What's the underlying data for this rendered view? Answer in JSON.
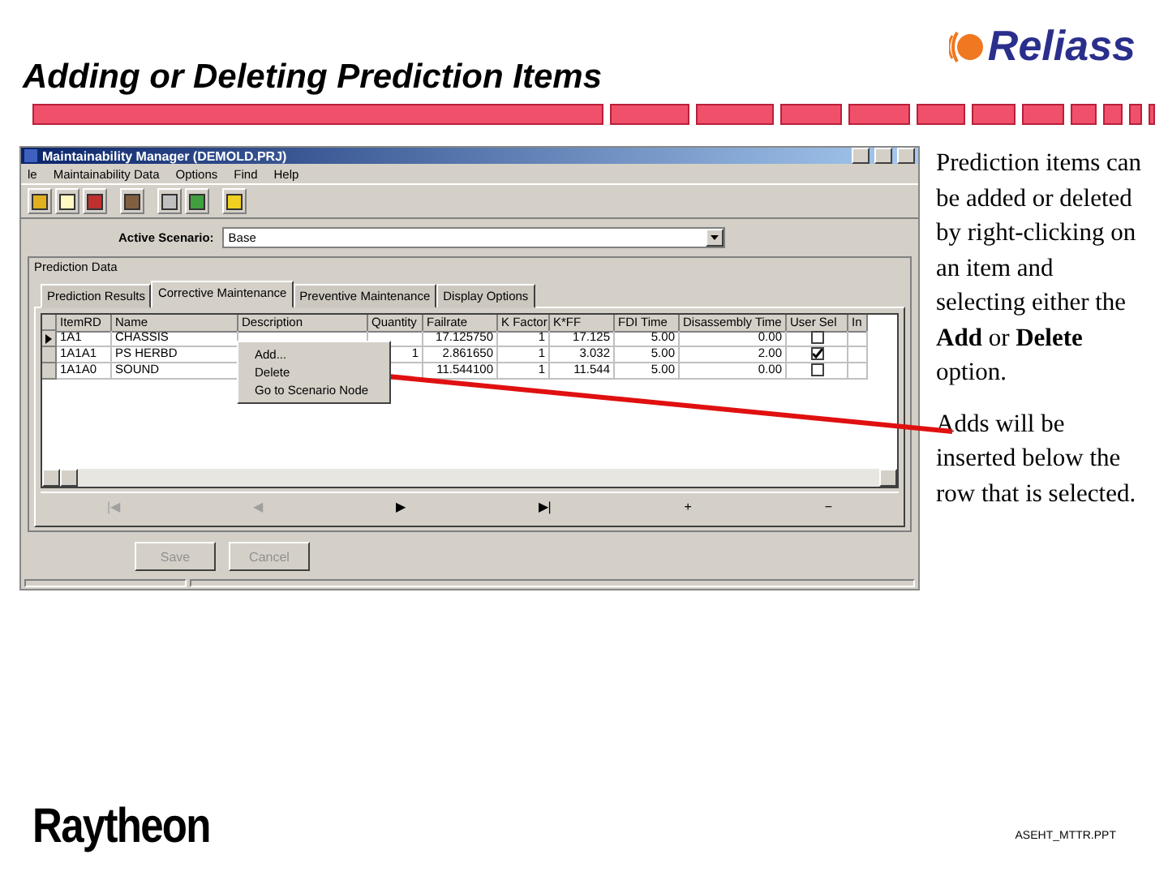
{
  "slide": {
    "title": "Adding or Deleting Prediction Items",
    "logo": "Reliass",
    "footer_logo": "Raytheon",
    "file_name": "ASEHT_MTTR.PPT",
    "notes": [
      "Prediction items can be added or deleted by right-clicking on an item and selecting either the **Add** or **Delete** option.",
      "Adds will be inserted below the row that is selected."
    ]
  },
  "window": {
    "title": "Maintainability Manager (DEMOLD.PRJ)",
    "menu": [
      "le",
      "Maintainability Data",
      "Options",
      "Find",
      "Help"
    ],
    "scenario": {
      "label": "Active Scenario:",
      "value": "Base"
    },
    "group_title": "Prediction Data",
    "tabs": [
      {
        "label": "Prediction Results",
        "selected": false
      },
      {
        "label": "Corrective Maintenance",
        "selected": true
      },
      {
        "label": "Preventive Maintenance",
        "selected": false
      },
      {
        "label": "Display Options",
        "selected": false
      }
    ],
    "columns": [
      "ItemRD",
      "Name",
      "Description",
      "Quantity",
      "Failrate",
      "K Factor",
      "K*FF",
      "FDI Time",
      "Disassembly Time",
      "User Sel",
      "In"
    ],
    "rows": [
      {
        "current": true,
        "cells": [
          "1A1",
          "CHASSIS",
          "",
          "",
          "17.125750",
          "1",
          "17.125",
          "5.00",
          "0.00"
        ],
        "user_sel": false
      },
      {
        "current": false,
        "cells": [
          "1A1A1",
          "PS HERBD",
          "",
          "1",
          "2.861650",
          "1",
          "3.032",
          "5.00",
          "2.00"
        ],
        "user_sel": true
      },
      {
        "current": false,
        "cells": [
          "1A1A0",
          "SOUND",
          "",
          "",
          "11.544100",
          "1",
          "11.544",
          "5.00",
          "0.00"
        ],
        "user_sel": false
      }
    ],
    "context_menu": [
      "Add...",
      "Delete",
      "Go to Scenario Node"
    ],
    "navigator": [
      {
        "glyph": "|◀",
        "disabled": true
      },
      {
        "glyph": "◀",
        "disabled": true
      },
      {
        "glyph": "▶",
        "disabled": false
      },
      {
        "glyph": "▶|",
        "disabled": false
      },
      {
        "glyph": "+",
        "disabled": false
      },
      {
        "glyph": "−",
        "disabled": false
      }
    ],
    "buttons": [
      {
        "label": "Save",
        "disabled": true
      },
      {
        "label": "Cancel",
        "disabled": true
      }
    ]
  }
}
